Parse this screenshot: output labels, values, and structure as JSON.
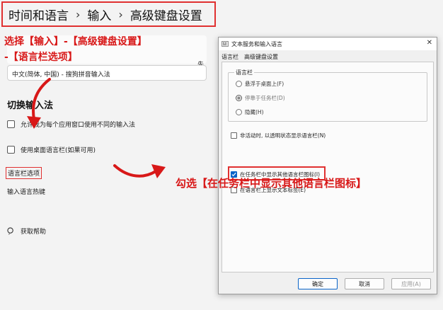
{
  "breadcrumb": {
    "items": [
      "时间和语言",
      "输入",
      "高级键盘设置"
    ],
    "separator": "›"
  },
  "left": {
    "annotation_line1": "选择【输入】-【高级键盘设置】",
    "annotation_line2": "-【语言栏选项】",
    "partial_label": "先",
    "default_ime": "中文(简体, 中国) - 搜狗拼音输入法",
    "switch_section_title": "切换输入法",
    "checkbox_per_app": "允许我为每个应用窗口使用不同的输入法",
    "checkbox_desktop_bar": "使用桌面语言栏(如果可用)",
    "link_language_bar_options": "语言栏选项",
    "link_hotkeys": "输入语言热键",
    "help_link": "获取帮助"
  },
  "dialog": {
    "title": "文本服务和输入语言",
    "close_glyph": "✕",
    "tabs": [
      "语言栏",
      "高级键盘设置"
    ],
    "group_label": "语言栏",
    "radios": [
      {
        "label": "悬浮于桌面上(F)",
        "selected": false,
        "disabled": false
      },
      {
        "label": "停靠于任务栏(D)",
        "selected": true,
        "disabled": true
      },
      {
        "label": "隐藏(H)",
        "selected": false,
        "disabled": false
      }
    ],
    "checkboxes": [
      {
        "label": "非活动时, 以透明状态显示语言栏(N)",
        "checked": false
      },
      {
        "label": "在任务栏中显示其他语言栏图标(I)",
        "checked": true
      },
      {
        "label": "在语言栏上显示文本标签(E)",
        "checked": false
      }
    ],
    "buttons": {
      "ok": "确定",
      "cancel": "取消",
      "apply": "应用(A)"
    }
  },
  "annotation_right": "勾选【在任务栏中显示其他语言栏图标】",
  "colors": {
    "annotation_red": "#d81818",
    "check_blue": "#0a64c8",
    "page_bg": "#f3f3f3"
  }
}
